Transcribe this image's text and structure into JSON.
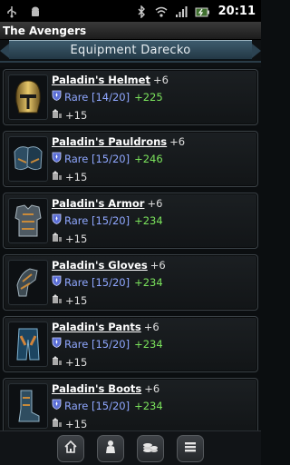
{
  "status_bar": {
    "time": "20:11",
    "left_icons": [
      "usb-icon",
      "android-debug-icon"
    ],
    "right_icons": [
      "bluetooth-icon",
      "wifi-icon",
      "signal-icon",
      "battery-icon"
    ]
  },
  "app": {
    "title": "The Avengers"
  },
  "header": {
    "title": "Equipment Darecko"
  },
  "items": [
    {
      "name": "Paladin's Helmet",
      "level": "+6",
      "rarity": "Rare [14/20]",
      "bonus": "+225",
      "stat": "+15",
      "icon": "helmet-icon"
    },
    {
      "name": "Paladin's Pauldrons",
      "level": "+6",
      "rarity": "Rare [15/20]",
      "bonus": "+246",
      "stat": "+15",
      "icon": "pauldrons-icon"
    },
    {
      "name": "Paladin's Armor",
      "level": "+6",
      "rarity": "Rare [15/20]",
      "bonus": "+234",
      "stat": "+15",
      "icon": "armor-icon"
    },
    {
      "name": "Paladin's Gloves",
      "level": "+6",
      "rarity": "Rare [15/20]",
      "bonus": "+234",
      "stat": "+15",
      "icon": "gloves-icon"
    },
    {
      "name": "Paladin's Pants",
      "level": "+6",
      "rarity": "Rare [15/20]",
      "bonus": "+234",
      "stat": "+15",
      "icon": "pants-icon"
    },
    {
      "name": "Paladin's Boots",
      "level": "+6",
      "rarity": "Rare [15/20]",
      "bonus": "+234",
      "stat": "+15",
      "icon": "boots-icon"
    }
  ],
  "nav": [
    "home-icon",
    "profile-icon",
    "coins-icon",
    "menu-icon"
  ],
  "colors": {
    "rarity": "#8fa7ff",
    "bonus": "#7be35c",
    "banner": "#2c4352"
  }
}
